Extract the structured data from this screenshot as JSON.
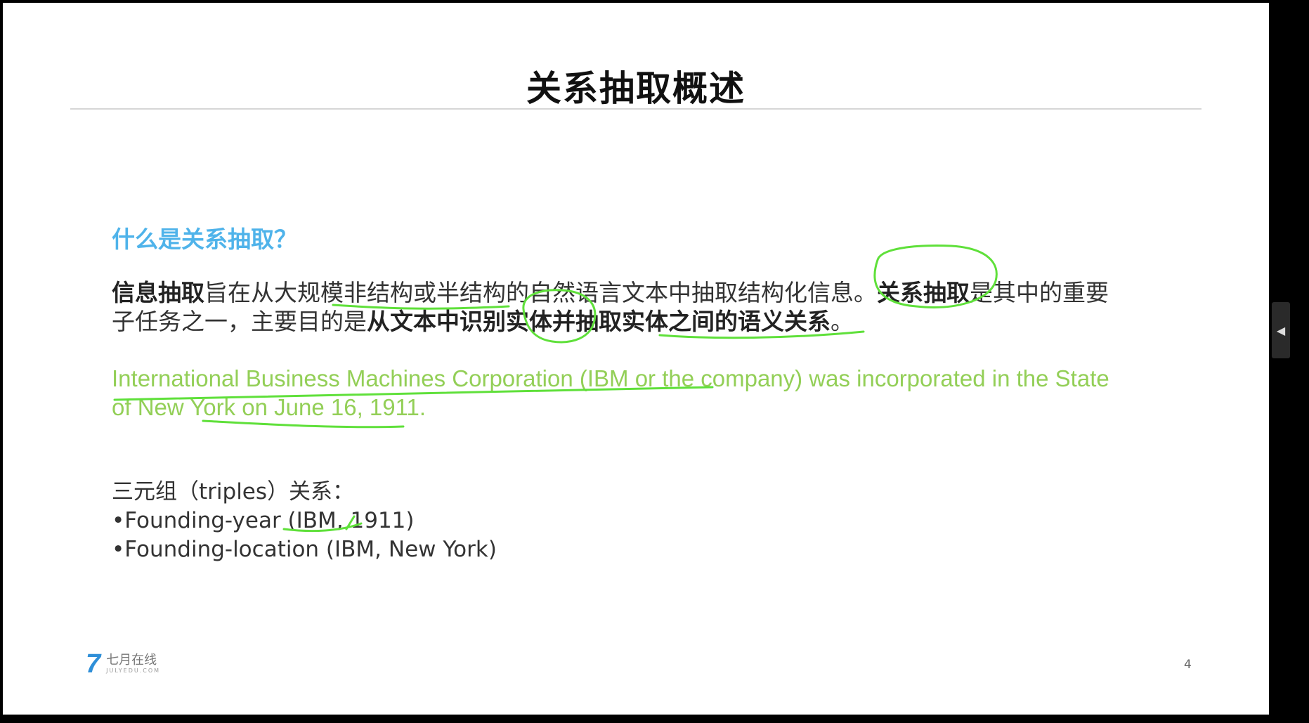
{
  "slide": {
    "title": "关系抽取概述",
    "question": "什么是关系抽取？",
    "paragraph": {
      "p1_bold": "信息抽取",
      "p2": "旨在从大规模非结构或半结构的自然语言文本中抽取结构化信息。",
      "p3_bold": "关系抽取",
      "p4": "是其中的重要子任务之一，主要目的是",
      "p5_bold": "从文本中识别实体并抽取实体之间的语义关系",
      "p6": "。"
    },
    "example": "International Business Machines Corporation (IBM or the company) was incorporated in the State of New York on June 16, 1911.",
    "triples": {
      "heading": "三元组（triples）关系：",
      "items": [
        "•Founding-year (IBM, 1911)",
        "•Founding-location (IBM, New York)"
      ]
    },
    "footer": {
      "logo_mark": "7",
      "logo_cn": "七月在线",
      "logo_en": "JULYEDU.COM",
      "page_number": "4"
    }
  },
  "side_handle": {
    "icon": "triangle-left-icon",
    "glyph": "◀"
  },
  "colors": {
    "question": "#4fb3ea",
    "example": "#93cf57",
    "annotation": "#5fe03a",
    "logo": "#2f8fd8"
  }
}
